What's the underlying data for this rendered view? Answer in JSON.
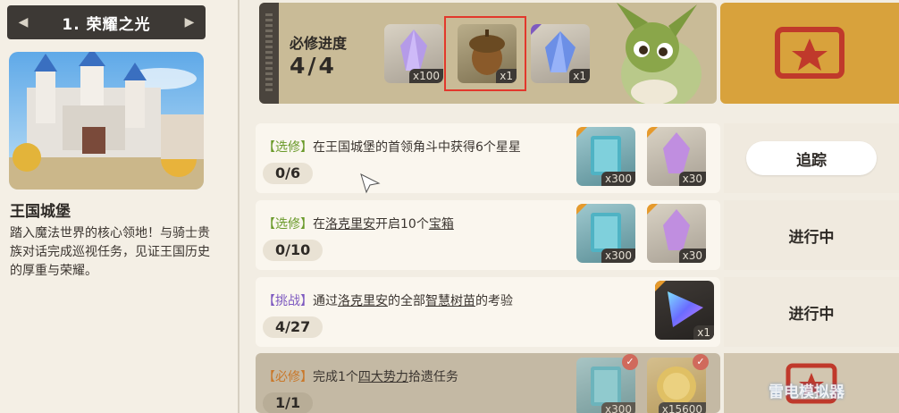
{
  "chapter": {
    "title": "1. 荣耀之光"
  },
  "location": {
    "name": "王国城堡",
    "description": "踏入魔法世界的核心领地！与骑士贵族对话完成巡视任务，见证王国历史的厚重与荣耀。"
  },
  "required": {
    "label": "必修进度",
    "count": "4/4",
    "rewards": [
      {
        "icon": "purple-crystal-icon",
        "qty": "x100"
      },
      {
        "icon": "acorn-icon",
        "qty": "x1"
      },
      {
        "icon": "blue-crystal-icon",
        "qty": "x1"
      }
    ]
  },
  "quests": [
    {
      "tag": "【选修】",
      "tag_color": "#6a9a2a",
      "text_before": "在王国城堡的首领角斗中获得6个星星",
      "link": "",
      "text_after": "",
      "progress": "0/6",
      "rewards": [
        {
          "icon": "blue-book-icon",
          "qty": "x300"
        },
        {
          "icon": "purple-crystal-icon",
          "qty": "x30"
        }
      ],
      "action": "追踪"
    },
    {
      "tag": "【选修】",
      "tag_color": "#6a9a2a",
      "text_before": "在",
      "link": "洛克里安",
      "text_mid": "开启10个",
      "link2": "宝箱",
      "progress": "0/10",
      "rewards": [
        {
          "icon": "blue-book-icon",
          "qty": "x300"
        },
        {
          "icon": "purple-crystal-icon",
          "qty": "x30"
        }
      ],
      "action": "进行中"
    },
    {
      "tag": "【挑战】",
      "tag_color": "#7e5ac0",
      "text_before": "通过",
      "link": "洛克里安",
      "text_mid": "的全部",
      "link2": "智慧树苗",
      "text_after": "的考验",
      "progress": "4/27",
      "rewards": [
        {
          "icon": "rainbow-gem-icon",
          "qty": "x1"
        }
      ],
      "action": "进行中"
    },
    {
      "tag": "【必修】",
      "tag_color": "#c9782a",
      "text_before": "完成1个",
      "link": "四大势力",
      "text_after": "拾遗任务",
      "progress": "1/1",
      "rewards": [
        {
          "icon": "blue-book-icon",
          "qty": "x300"
        },
        {
          "icon": "gold-coin-icon",
          "qty": "x15600"
        }
      ],
      "action": ""
    }
  ],
  "watermark": "雷电模拟器",
  "colors": {
    "accent_red": "#e2382c",
    "ribbon_gold": "#d8a23c",
    "panel_dark": "#3d3935"
  }
}
